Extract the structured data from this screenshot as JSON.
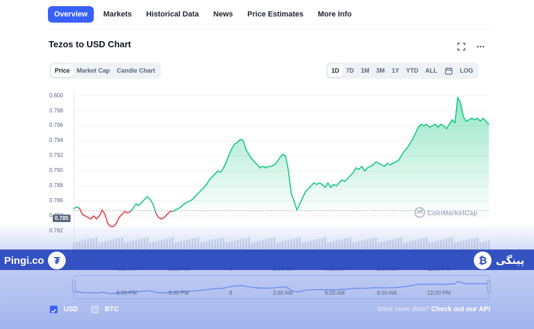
{
  "nav": {
    "items": [
      "Overview",
      "Markets",
      "Historical Data",
      "News",
      "Price Estimates",
      "More Info"
    ],
    "active": "Overview"
  },
  "chart_header": {
    "title": "Tezos to USD Chart",
    "icons": [
      "fullscreen-icon",
      "more-icon"
    ]
  },
  "type_tabs": {
    "items": [
      "Price",
      "Market Cap",
      "Candle Chart"
    ],
    "active": "Price"
  },
  "range_tabs": {
    "items": [
      "1D",
      "7D",
      "1M",
      "3M",
      "1Y",
      "YTD",
      "ALL"
    ],
    "active": "1D",
    "calendar_icon": "calendar-icon",
    "log_label": "LOG"
  },
  "watermark": "CoinMarketCap",
  "current_price": "0.785",
  "chart_data": {
    "type": "line",
    "title": "Tezos to USD Chart",
    "y_ticks": [
      "0.800",
      "0.798",
      "0.796",
      "0.794",
      "0.792",
      "0.790",
      "0.788",
      "0.786",
      "0.784",
      "0.782"
    ],
    "ylim": [
      0.781,
      0.8006
    ],
    "x_ticks": [
      "6:00 PM",
      "9:00 PM",
      "8",
      "3:00 AM",
      "6:00 AM",
      "9:00 AM",
      "12:00 PM"
    ],
    "reference_price": 0.7847,
    "series": [
      {
        "values": [
          0.785,
          0.7852,
          0.785,
          0.7842,
          0.784,
          0.7838,
          0.7836,
          0.784,
          0.7836,
          0.784,
          0.7848,
          0.7842,
          0.783,
          0.7826,
          0.7826,
          0.783,
          0.7838,
          0.7842,
          0.7846,
          0.7844,
          0.7846,
          0.785,
          0.7856,
          0.7854,
          0.7858,
          0.7862,
          0.7866,
          0.7862,
          0.7856,
          0.7844,
          0.7838,
          0.7836,
          0.7838,
          0.7842,
          0.7846,
          0.7846,
          0.7848,
          0.785,
          0.7852,
          0.7856,
          0.7858,
          0.786,
          0.7862,
          0.7866,
          0.787,
          0.7874,
          0.7878,
          0.7882,
          0.7888,
          0.7892,
          0.7896,
          0.79,
          0.7898,
          0.7904,
          0.7912,
          0.7922,
          0.793,
          0.7936,
          0.7938,
          0.7942,
          0.794,
          0.7928,
          0.7922,
          0.7916,
          0.7912,
          0.7908,
          0.7904,
          0.7906,
          0.7904,
          0.7906,
          0.7906,
          0.7908,
          0.7912,
          0.7918,
          0.7922,
          0.792,
          0.79,
          0.787,
          0.786,
          0.7848,
          0.7856,
          0.7864,
          0.7872,
          0.7876,
          0.788,
          0.7884,
          0.7882,
          0.7884,
          0.7882,
          0.7878,
          0.7884,
          0.7878,
          0.7882,
          0.788,
          0.7884,
          0.7888,
          0.7886,
          0.789,
          0.7894,
          0.7898,
          0.7904,
          0.7902,
          0.7906,
          0.79,
          0.7904,
          0.7906,
          0.7908,
          0.7912,
          0.791,
          0.7908,
          0.7906,
          0.791,
          0.7908,
          0.791,
          0.7912,
          0.7914,
          0.792,
          0.7926,
          0.793,
          0.7936,
          0.7942,
          0.795,
          0.7958,
          0.7962,
          0.796,
          0.7962,
          0.7958,
          0.796,
          0.7962,
          0.7958,
          0.7962,
          0.796,
          0.7956,
          0.7962,
          0.7968,
          0.7964,
          0.7998,
          0.799,
          0.7972,
          0.7966,
          0.7968,
          0.797,
          0.7968,
          0.797,
          0.7966,
          0.797,
          0.7966,
          0.7962
        ]
      }
    ],
    "colors": {
      "up": "#16c784",
      "down": "#ea3943",
      "fill": "#c9f0dc"
    },
    "grid": true
  },
  "navigator": {
    "x_ticks": [
      "6:00 PM",
      "9:00 PM",
      "8",
      "3:00 AM",
      "6:00 AM",
      "9:00 AM",
      "12:00 PM"
    ]
  },
  "currency_toggles": [
    {
      "label": "USD",
      "checked": true
    },
    {
      "label": "BTC",
      "checked": false
    }
  ],
  "api_prompt": {
    "text": "Want more data?",
    "link": "Check out our API"
  },
  "branding": {
    "left_name": "Pingi.co",
    "right_name": "پینگی"
  }
}
